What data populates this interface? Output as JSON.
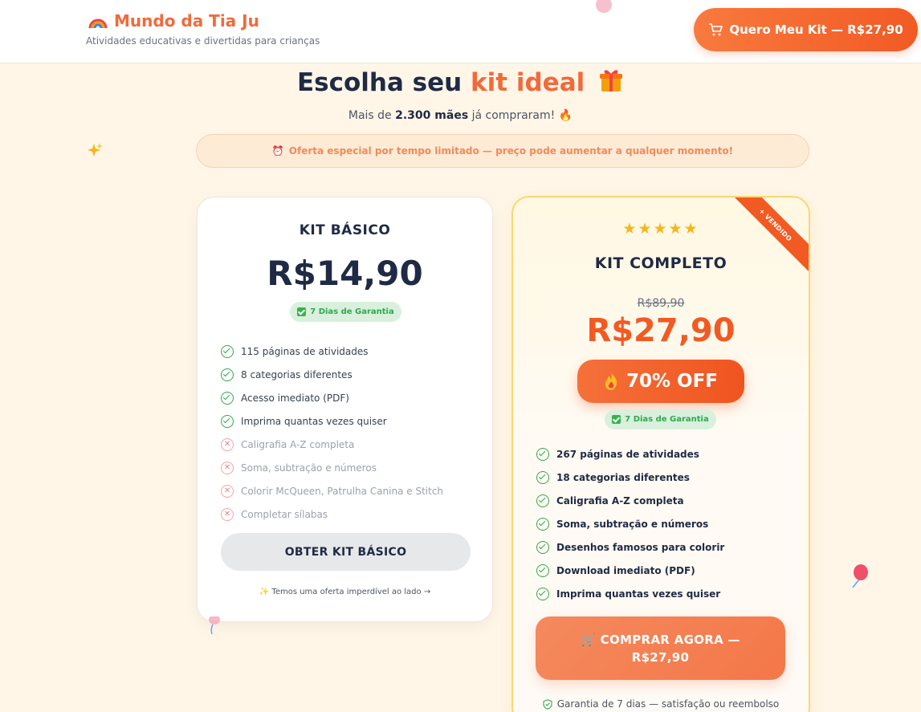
{
  "header": {
    "brand_name": "Mundo da Tia Ju",
    "tagline": "Atividades educativas e divertidas para crianças",
    "cta_label": "Quero Meu Kit — R$27,90"
  },
  "hero": {
    "title_prefix": "Escolha seu ",
    "title_accent": "kit ideal",
    "subtitle_prefix": "Mais de ",
    "subtitle_bold": "2.300 mães",
    "subtitle_suffix": " já compraram! 🔥",
    "offer_icon": "⏰",
    "offer_text": "Oferta especial por tempo limitado — preço pode aumentar a qualquer momento!"
  },
  "basic_kit": {
    "title": "KIT BÁSICO",
    "price": "R$14,90",
    "guarantee": "7 Dias de Garantia",
    "features": [
      {
        "label": "115 páginas de atividades",
        "included": true
      },
      {
        "label": "8 categorias diferentes",
        "included": true
      },
      {
        "label": "Acesso imediato (PDF)",
        "included": true
      },
      {
        "label": "Imprima quantas vezes quiser",
        "included": true
      },
      {
        "label": "Caligrafia A-Z completa",
        "included": false
      },
      {
        "label": "Soma, subtração e números",
        "included": false
      },
      {
        "label": "Colorir McQueen, Patrulha Canina e Stitch",
        "included": false
      },
      {
        "label": "Completar sílabas",
        "included": false
      }
    ],
    "button_label": "OBTER KIT BÁSICO",
    "note": "✨ Temos uma oferta imperdível ao lado →"
  },
  "complete_kit": {
    "ribbon": "+ VENDIDO",
    "stars": "★★★★★",
    "title": "KIT COMPLETO",
    "old_price": "R$89,90",
    "price": "R$27,90",
    "discount": "70% OFF",
    "guarantee": "7 Dias de Garantia",
    "features": [
      "267 páginas de atividades",
      "18 categorias diferentes",
      "Caligrafia A-Z completa",
      "Soma, subtração e números",
      "Desenhos famosos para colorir",
      "Download imediato (PDF)",
      "Imprima quantas vezes quiser"
    ],
    "button_line1": "🛒 COMPRAR AGORA —",
    "button_line2": "R$27,90",
    "note": "Garantia de 7 dias — satisfação ou reembolso"
  },
  "colors": {
    "brand": "#f26a3a",
    "accent": "#f25a24",
    "success": "#2fa84f",
    "background": "#fff6e8"
  }
}
